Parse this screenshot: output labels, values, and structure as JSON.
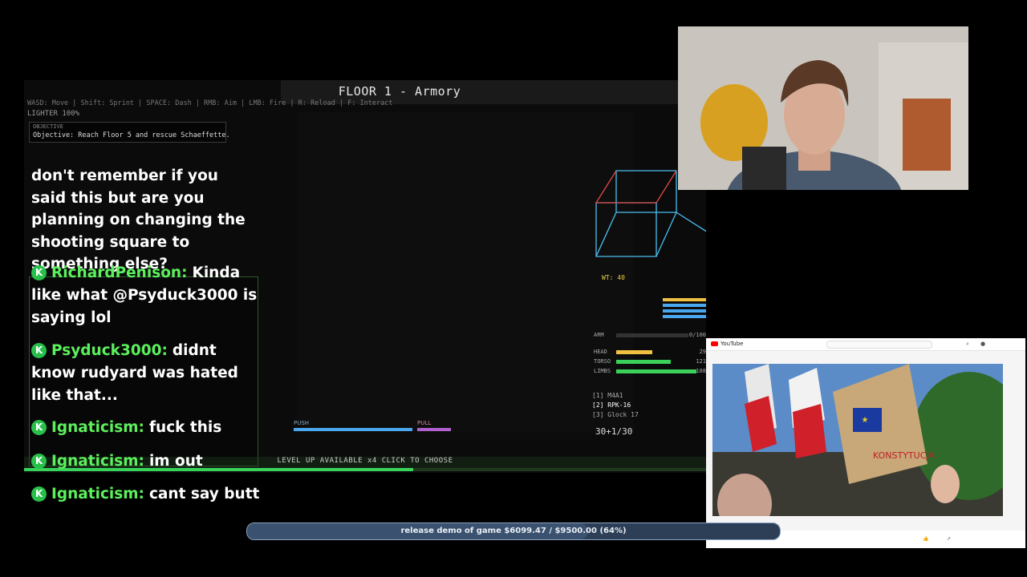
{
  "game": {
    "floor_title": "FLOOR 1 - Armory",
    "controls": "WASD: Move | Shift: Sprint | SPACE: Dash | RMB: Aim | LMB: Fire | R: Reload | F: Interact",
    "lighter": "LIGHTER 100%",
    "objective_header": "OBJECTIVE",
    "objective_text": "Objective: Reach Floor 5 and rescue Schaeffette.",
    "wt_label": "WT: 40",
    "hud": {
      "arm": {
        "label": "ARM",
        "value": "0/100"
      },
      "head": {
        "label": "HEAD",
        "value": "29"
      },
      "torso": {
        "label": "TORSO",
        "value": "121"
      },
      "limbs": {
        "label": "LIMBS",
        "value": "108"
      }
    },
    "weapons": [
      "[1]  M4A1",
      "[2]  RPK-16",
      "[3]  Glock 17"
    ],
    "ammo": "30+1/30",
    "skills_push": "PUSH",
    "skills_pull": "PULL",
    "level_up": "LEVEL UP AVAILABLE  x4   CLICK TO CHOOSE"
  },
  "chat": {
    "question": "don't remember if you said this but are you planning on changing the shooting square to something else?",
    "messages": [
      {
        "user": "RichardPenison:",
        "text": "Kinda like what @Psyduck3000 is saying lol"
      },
      {
        "user": "Psyduck3000:",
        "text": "didnt know rudyard was hated like that..."
      },
      {
        "user": "Ignaticism:",
        "text": "fuck this"
      },
      {
        "user": "Ignaticism:",
        "text": "im out"
      },
      {
        "user": "Ignaticism:",
        "text": "cant say butt"
      }
    ]
  },
  "youtube": {
    "logo": "YouTube",
    "sign_text": "KONSTYTUCJA"
  },
  "goal": {
    "text": "release demo of game $6099.47 / $9500.00 (64%)",
    "progress": 0.64
  },
  "colors": {
    "chat_user": "#5cf15c",
    "badge": "#27c04a",
    "goal_bar": "#2c3f56",
    "xp_bar": "#38d45a"
  }
}
